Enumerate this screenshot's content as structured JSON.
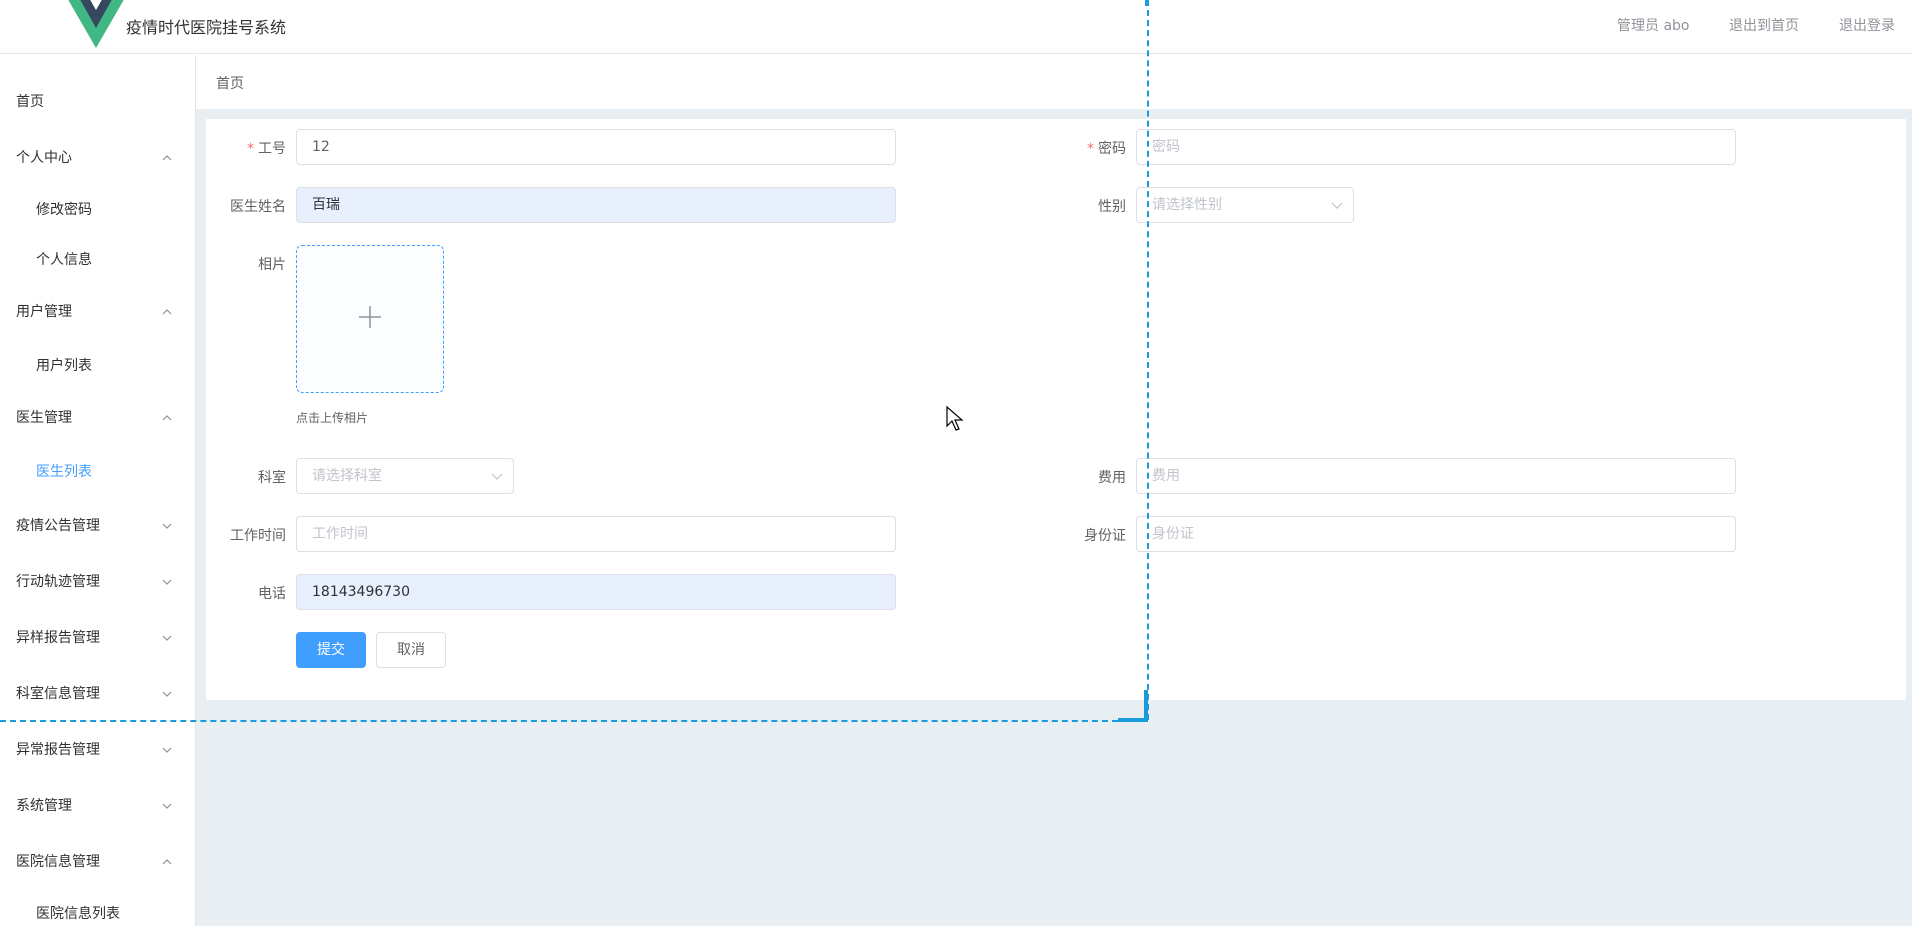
{
  "header": {
    "app_title": "疫情时代医院挂号系统",
    "admin_label": "管理员 abo",
    "back_home": "退出到首页",
    "logout": "退出登录"
  },
  "sidebar": {
    "items": [
      {
        "label": "首页",
        "type": "top",
        "chevron": "none"
      },
      {
        "label": "个人中心",
        "type": "top",
        "chevron": "up"
      },
      {
        "label": "修改密码",
        "type": "sub"
      },
      {
        "label": "个人信息",
        "type": "sub"
      },
      {
        "label": "用户管理",
        "type": "top",
        "chevron": "up"
      },
      {
        "label": "用户列表",
        "type": "sub"
      },
      {
        "label": "医生管理",
        "type": "top",
        "chevron": "up"
      },
      {
        "label": "医生列表",
        "type": "sub",
        "active": true
      },
      {
        "label": "疫情公告管理",
        "type": "top",
        "chevron": "down"
      },
      {
        "label": "行动轨迹管理",
        "type": "top",
        "chevron": "down"
      },
      {
        "label": "异样报告管理",
        "type": "top",
        "chevron": "down"
      },
      {
        "label": "科室信息管理",
        "type": "top",
        "chevron": "down"
      },
      {
        "label": "异常报告管理",
        "type": "top",
        "chevron": "down"
      },
      {
        "label": "系统管理",
        "type": "top",
        "chevron": "down"
      },
      {
        "label": "医院信息管理",
        "type": "top",
        "chevron": "up"
      },
      {
        "label": "医院信息列表",
        "type": "sub"
      }
    ]
  },
  "breadcrumb": "首页",
  "form": {
    "job_no": {
      "label": "工号",
      "value": "12",
      "required": true
    },
    "password": {
      "label": "密码",
      "placeholder": "密码",
      "required": true
    },
    "doctor_name": {
      "label": "医生姓名",
      "value": "百瑞"
    },
    "gender": {
      "label": "性别",
      "placeholder": "请选择性别"
    },
    "photo": {
      "label": "相片",
      "tip": "点击上传相片"
    },
    "department": {
      "label": "科室",
      "placeholder": "请选择科室"
    },
    "fee": {
      "label": "费用",
      "placeholder": "费用"
    },
    "work_time": {
      "label": "工作时间",
      "placeholder": "工作时间"
    },
    "id_card": {
      "label": "身份证",
      "placeholder": "身份证"
    },
    "phone": {
      "label": "电话",
      "value": "18143496730"
    },
    "submit": "提交",
    "cancel": "取消"
  },
  "colors": {
    "primary": "#409eff",
    "required": "#f56c6c",
    "selection": "#1a9bde",
    "logo_green": "#41b883",
    "logo_dark": "#35495e"
  }
}
